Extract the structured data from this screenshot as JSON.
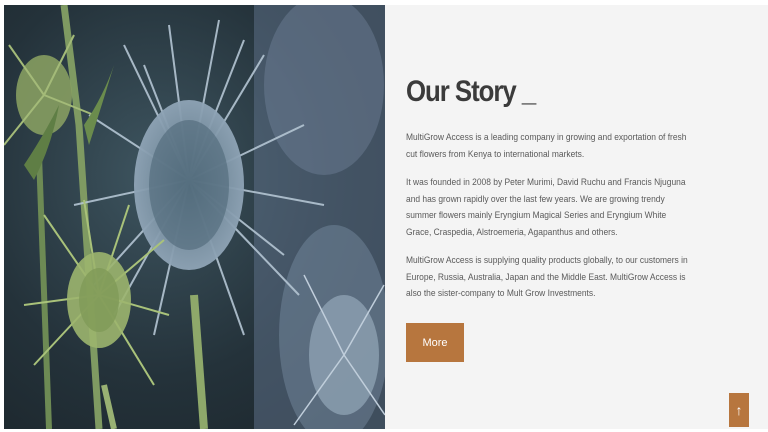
{
  "hero_image": {
    "alt": "",
    "colors": {
      "background": "#27343c",
      "thistle": "#9fb2c3",
      "stem": "#8ea86a"
    }
  },
  "story": {
    "title": "Our Story _",
    "paragraphs": [
      "MultiGrow Access is a leading company in growing and exportation of fresh cut flowers from Kenya to international markets.",
      "It was founded in 2008 by Peter Murimi, David Ruchu and Francis Njuguna and has grown rapidly over the last few years. We are growing trendy summer flowers mainly Eryngium Magical Series and Eryngium White Grace, Craspedia, Alstroemeria, Agapanthus and others.",
      "MultiGrow Access is supplying quality products globally, to our customers in Europe, Russia, Australia, Japan and the Middle East. MultiGrow Access is also the sister-company to Mult Grow Investments."
    ],
    "button_label": "More"
  },
  "scroll_top": {
    "label": "↑",
    "icon": "arrow-up-icon"
  },
  "colors": {
    "accent": "#b7763e",
    "panel_bg": "#f4f4f4",
    "title": "#3b3b3b",
    "text": "#5a5a5a"
  }
}
